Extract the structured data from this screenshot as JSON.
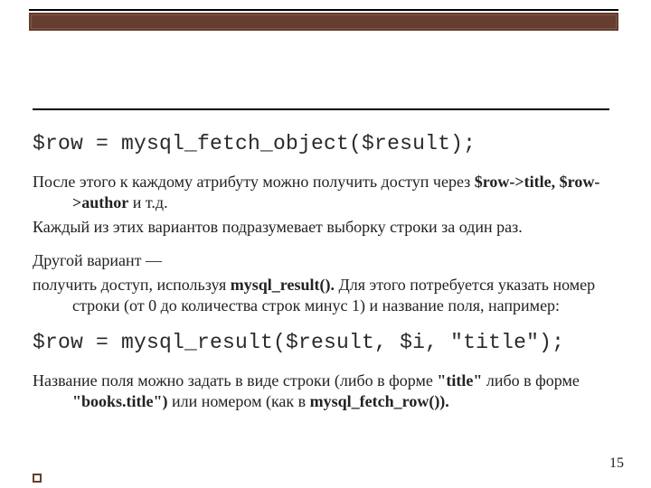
{
  "code1": "$row = mysql_fetch_object($result);",
  "p1a": "После этого к каждому атрибуту можно получить доступ через ",
  "p1b": "$row->title,  $row->author",
  "p1c": " и т.д.",
  "p2": "Каждый из этих вариантов подразумевает выборку строки за один раз.",
  "p3": "Другой вариант —",
  "p4a": "получить доступ, используя ",
  "p4b": "mysql_result().",
  "p4c": " Для этого потребуется указать номер строки (от 0 до количества строк минус 1) и название поля, например:",
  "code2": "$row = mysql_result($result, $i, \"title\");",
  "p5a": "Название поля можно задать в виде строки (либо в форме ",
  "p5b": "\"title\"",
  "p5c": " либо в форме  ",
  "p5d": "\"books.title\")",
  "p5e": " или номером (как в ",
  "p5f": "mysql_fetch_row()).",
  "page_number": "15"
}
